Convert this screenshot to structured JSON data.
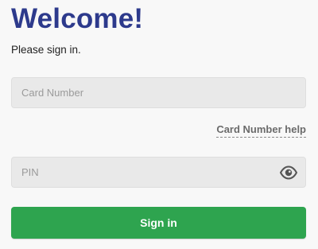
{
  "header": {
    "title": "Welcome!",
    "subtitle": "Please sign in."
  },
  "form": {
    "card_number": {
      "placeholder": "Card Number",
      "value": ""
    },
    "help_link": "Card Number help",
    "pin": {
      "placeholder": "PIN",
      "value": "",
      "toggle_icon": "eye-icon"
    },
    "submit_label": "Sign in"
  },
  "colors": {
    "title": "#2d3a8c",
    "button": "#2ea44f",
    "field_bg": "#e9e9e9"
  }
}
